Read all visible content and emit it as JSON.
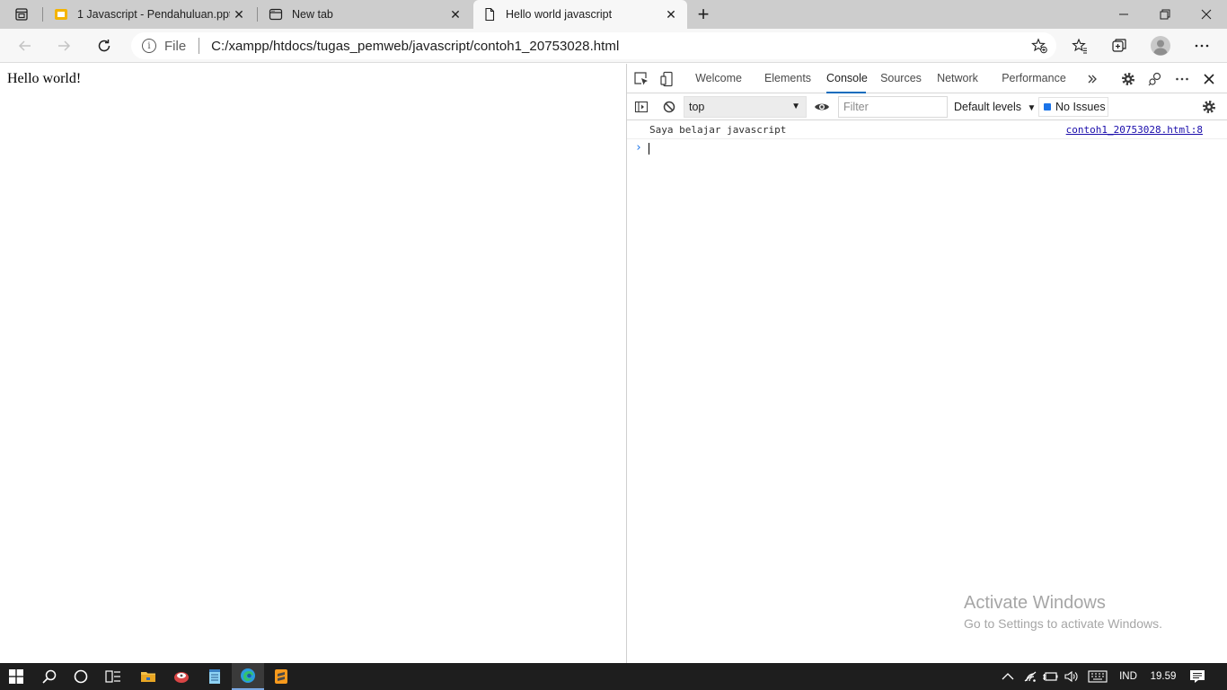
{
  "browser": {
    "tabs": [
      {
        "title": "1 Javascript - Pendahuluan.pptx",
        "icon": "slides-icon",
        "icon_color": "#f4b400"
      },
      {
        "title": "New tab",
        "icon": "new-tab-page-icon"
      },
      {
        "title": "Hello world javascript",
        "icon": "document-icon",
        "active": true
      }
    ],
    "address": {
      "scheme_label": "File",
      "url": "C:/xampp/htdocs/tugas_pemweb/javascript/contoh1_20753028.html"
    }
  },
  "page": {
    "text": "Hello world!"
  },
  "devtools": {
    "tabs": [
      "Welcome",
      "Elements",
      "Console",
      "Sources",
      "Network",
      "Performance"
    ],
    "active_tab": "Console",
    "context": "top",
    "filter_placeholder": "Filter",
    "levels_label": "Default levels",
    "issues_label": "No Issues",
    "console": {
      "messages": [
        {
          "text": "Saya belajar javascript",
          "source": "contoh1_20753028.html:8"
        }
      ],
      "prompt_symbol": "›"
    }
  },
  "watermark": {
    "title": "Activate Windows",
    "subtitle": "Go to Settings to activate Windows."
  },
  "taskbar": {
    "language": "IND",
    "time": "19.59",
    "active_color": "#7aa7e0"
  },
  "colors": {
    "accent": "#0f6cbd",
    "link": "#1a0dab"
  }
}
